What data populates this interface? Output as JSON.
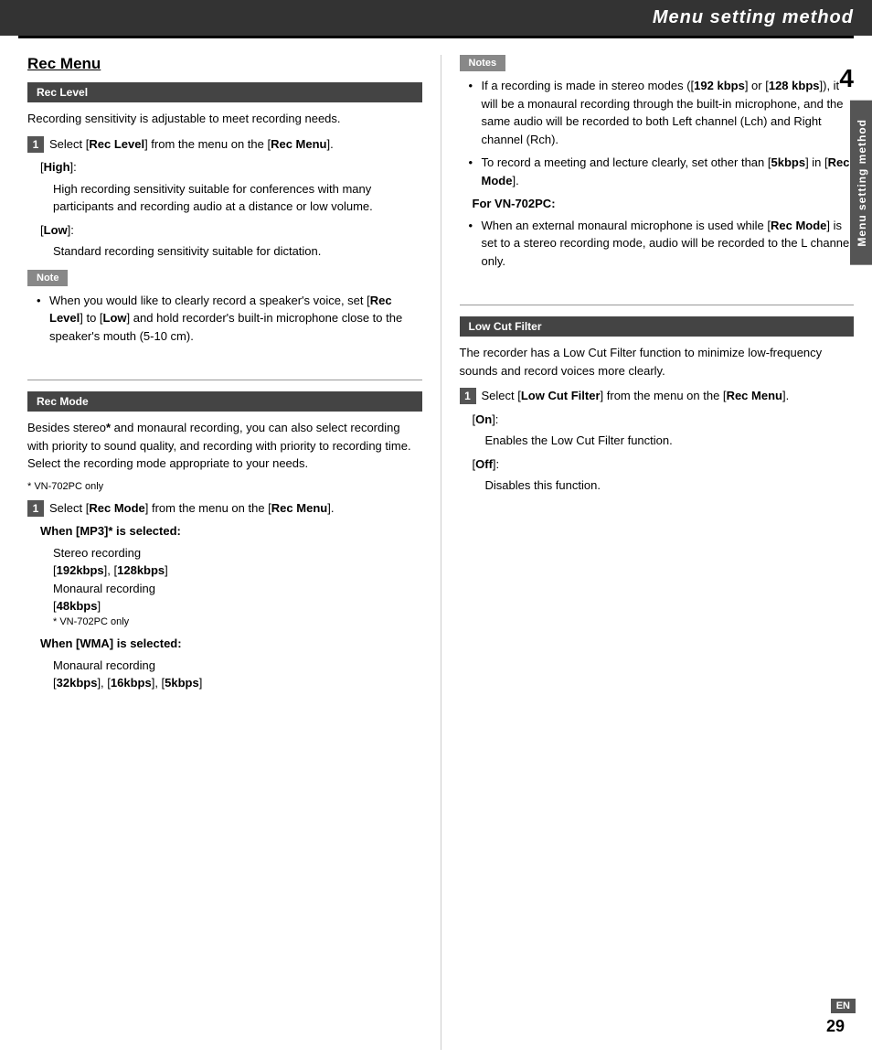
{
  "header": {
    "title": "Menu setting method"
  },
  "left_col": {
    "section_title": "Rec Menu",
    "rec_level": {
      "bar_label": "Rec Level",
      "intro": "Recording sensitivity is adjustable to meet recording needs.",
      "step1": {
        "num": "1",
        "text": "Select [Rec Level] from the menu on the [Rec Menu]."
      },
      "high_label": "[High]:",
      "high_desc": "High recording sensitivity suitable for conferences with many participants and recording audio at a distance or low volume.",
      "low_label": "[Low]:",
      "low_desc": "Standard recording sensitivity suitable for dictation."
    },
    "note": {
      "bar_label": "Note",
      "bullet1": "When you would like to clearly record a speaker's voice, set [Rec Level] to [Low] and hold recorder's built-in microphone close to the speaker's mouth (5-10 cm)."
    },
    "rec_mode": {
      "bar_label": "Rec Mode",
      "intro": "Besides stereo* and monaural recording, you can also select recording with priority to sound quality, and recording with priority to recording time. Select the recording mode appropriate to your needs.",
      "footnote": "* VN-702PC only",
      "step1": {
        "num": "1",
        "text": "Select [Rec Mode] from the menu on the [Rec Menu]."
      },
      "mp3_heading": "When [MP3]* is selected:",
      "mp3_stereo": "Stereo recording",
      "mp3_stereo_opts": "[192kbps], [128kbps]",
      "mp3_mono": "Monaural recording",
      "mp3_mono_opts": "[48kbps]",
      "mp3_footnote": "* VN-702PC only",
      "wma_heading": "When [WMA] is selected:",
      "wma_mono": "Monaural recording",
      "wma_mono_opts": "[32kbps], [16kbps], [5kbps]"
    }
  },
  "right_col": {
    "notes": {
      "bar_label": "Notes",
      "bullet1_parts": {
        "before": "If a recording is made in stereo modes ([",
        "bold1": "192 kbps",
        "mid1": "] or [",
        "bold2": "128 kbps",
        "after": "]), it will be a monaural recording through the built-in microphone, and the same audio will be recorded to both Left channel (Lch) and Right channel (Rch)."
      },
      "bullet2_parts": {
        "before": "To record a meeting and lecture clearly, set other than [",
        "bold1": "5kbps",
        "mid": "] in [",
        "bold2": "Rec Mode",
        "after": "]."
      },
      "for_vn": {
        "heading": "For VN-702PC:",
        "bullet_parts": {
          "before": "When an external monaural microphone is used while [",
          "bold1": "Rec Mode",
          "after": "] is set to a stereo recording mode, audio will be recorded to the L channel only."
        }
      }
    },
    "low_cut_filter": {
      "bar_label": "Low Cut Filter",
      "intro": "The recorder has a Low Cut Filter function to minimize low-frequency sounds and record voices more clearly.",
      "step1": {
        "num": "1",
        "text": "Select [Low Cut Filter] from the menu on the [Rec Menu]."
      },
      "on_label": "[On]:",
      "on_desc": "Enables the Low Cut Filter function.",
      "off_label": "[Off]:",
      "off_desc": "Disables this function."
    },
    "chapter_num": "4",
    "side_tab": "Menu setting method",
    "en_badge": "EN",
    "page_num": "29"
  }
}
